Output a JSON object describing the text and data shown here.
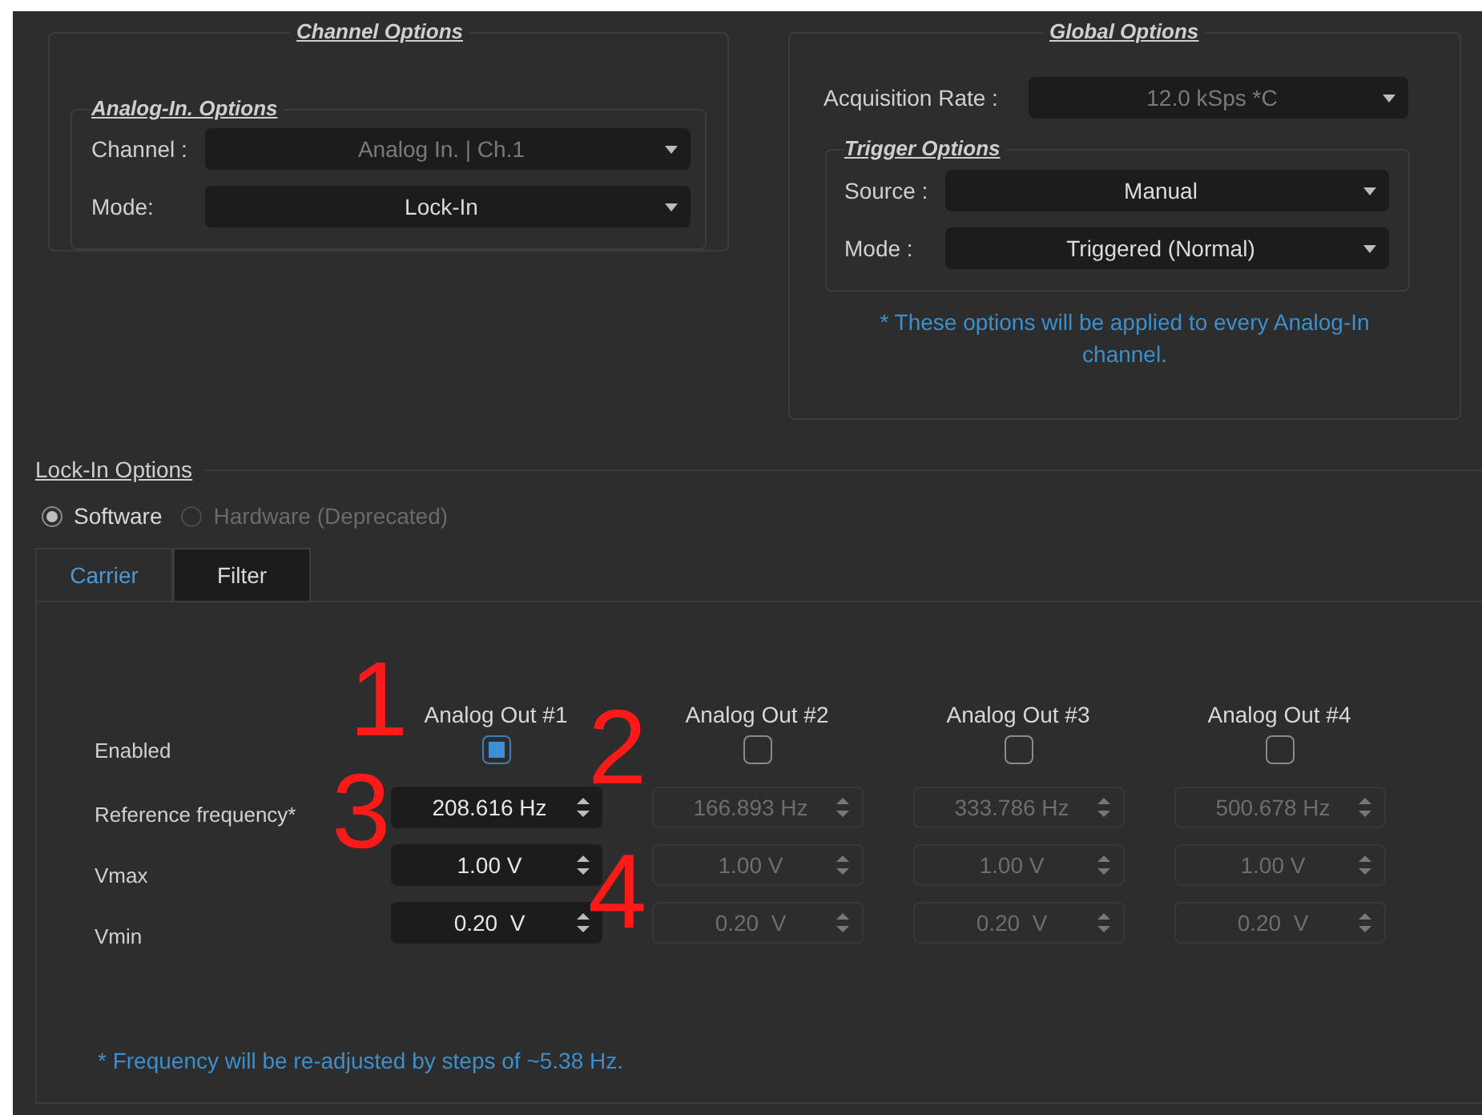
{
  "channel_options": {
    "title": "Channel Options",
    "analog_in": {
      "title": "Analog-In. Options",
      "rows": [
        {
          "label": "Channel :",
          "value": "Analog In. | Ch.1",
          "disabled": true
        },
        {
          "label": "Mode:",
          "value": "Lock-In",
          "disabled": false
        }
      ]
    }
  },
  "global_options": {
    "title": "Global Options",
    "acquisition": {
      "label": "Acquisition Rate :",
      "value": "12.0 kSps *C",
      "disabled": true
    },
    "trigger": {
      "title": "Trigger Options",
      "rows": [
        {
          "label": "Source :",
          "value": "Manual",
          "disabled": false
        },
        {
          "label": "Mode :",
          "value": "Triggered (Normal)",
          "disabled": false
        }
      ]
    },
    "note": "* These options will be applied to every Analog-In channel."
  },
  "lockin": {
    "title": "Lock-In Options",
    "radios": [
      {
        "label": "Software",
        "selected": true,
        "disabled": false
      },
      {
        "label": "Hardware (Deprecated)",
        "selected": false,
        "disabled": true
      }
    ],
    "tabs": [
      {
        "label": "Carrier",
        "selected": true
      },
      {
        "label": "Filter",
        "selected": false
      }
    ],
    "row_labels": [
      "Enabled",
      "Reference frequency*",
      "Vmax",
      "Vmin"
    ],
    "columns": [
      {
        "header": "Analog Out #1",
        "checked": true,
        "fields": [
          "208.616 Hz",
          "1.00 V",
          "0.20  V"
        ]
      },
      {
        "header": "Analog Out #2",
        "checked": false,
        "fields": [
          "166.893 Hz",
          "1.00 V",
          "0.20  V"
        ]
      },
      {
        "header": "Analog Out #3",
        "checked": false,
        "fields": [
          "333.786 Hz",
          "1.00 V",
          "0.20  V"
        ]
      },
      {
        "header": "Analog Out #4",
        "checked": false,
        "fields": [
          "500.678 Hz",
          "1.00 V",
          "0.20  V"
        ]
      }
    ],
    "note": "* Frequency will be re-adjusted by steps of ~5.38 Hz."
  },
  "annotations": [
    "1",
    "2",
    "3",
    "4"
  ]
}
